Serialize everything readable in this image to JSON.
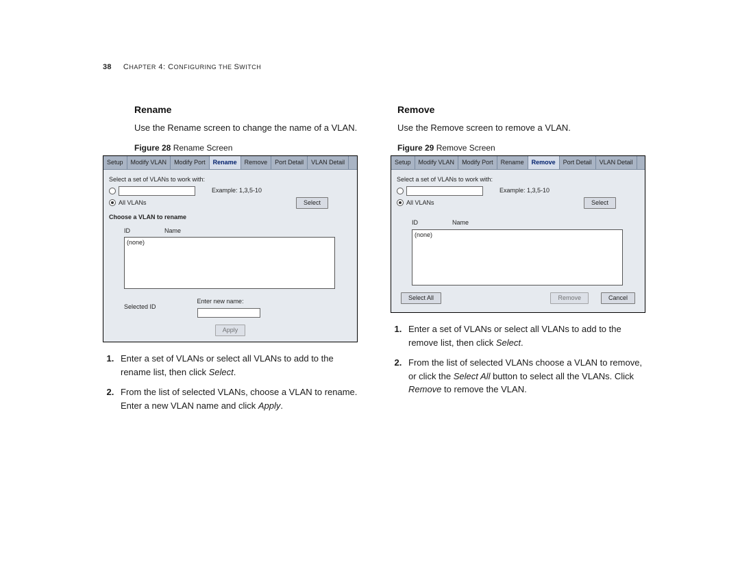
{
  "header": {
    "page_number": "38",
    "chapter_prefix": "C",
    "chapter_word": "HAPTER",
    "chapter_num": " 4: C",
    "chapter_rest": "ONFIGURING THE ",
    "switch_c": "S",
    "switch_rest": "WITCH"
  },
  "left_col": {
    "title": "Rename",
    "description": "Use the Rename screen to change the name of a VLAN.",
    "figure_label_bold": "Figure 28",
    "figure_label_rest": "   Rename Screen",
    "screenshot": {
      "tabs": [
        "Setup",
        "Modify VLAN",
        "Modify Port",
        "Rename",
        "Remove",
        "Port Detail",
        "VLAN Detail"
      ],
      "active_tab_index": 3,
      "select_label": "Select a set of VLANs to work with:",
      "example_text": "Example: 1,3,5-10",
      "all_vlans_label": "All VLANs",
      "select_button": "Select",
      "choose_label": "Choose a VLAN to rename",
      "col_id": "ID",
      "col_name": "Name",
      "list_placeholder": "(none)",
      "selected_id_label": "Selected ID",
      "new_name_label": "Enter new name:",
      "apply_button": "Apply"
    },
    "steps": [
      {
        "text_before": "Enter a set of VLANs or select all VLANs to add to the rename list, then click ",
        "em": "Select",
        "text_after": "."
      },
      {
        "text_before": "From the list of selected VLANs, choose a VLAN to rename. Enter a new VLAN name and click ",
        "em": "Apply",
        "text_after": "."
      }
    ]
  },
  "right_col": {
    "title": "Remove",
    "description": "Use the Remove screen to remove a VLAN.",
    "figure_label_bold": "Figure 29",
    "figure_label_rest": "   Remove Screen",
    "screenshot": {
      "tabs": [
        "Setup",
        "Modify VLAN",
        "Modify Port",
        "Rename",
        "Remove",
        "Port Detail",
        "VLAN Detail"
      ],
      "active_tab_index": 4,
      "select_label": "Select a set of VLANs to work with:",
      "example_text": "Example: 1,3,5-10",
      "all_vlans_label": "All VLANs",
      "select_button": "Select",
      "col_id": "ID",
      "col_name": "Name",
      "list_placeholder": "(none)",
      "select_all_button": "Select All",
      "remove_button": "Remove",
      "cancel_button": "Cancel"
    },
    "steps": [
      {
        "text_before": "Enter a set of VLANs or select all VLANs to add to the remove list, then click ",
        "em": "Select",
        "text_after": "."
      },
      {
        "text_before": "From the list of selected VLANs choose a VLAN to remove, or click the ",
        "em": "Select All",
        "text_mid": " button to select all the VLANs. Click ",
        "em2": "Remove",
        "text_after": " to remove the VLAN."
      }
    ]
  }
}
